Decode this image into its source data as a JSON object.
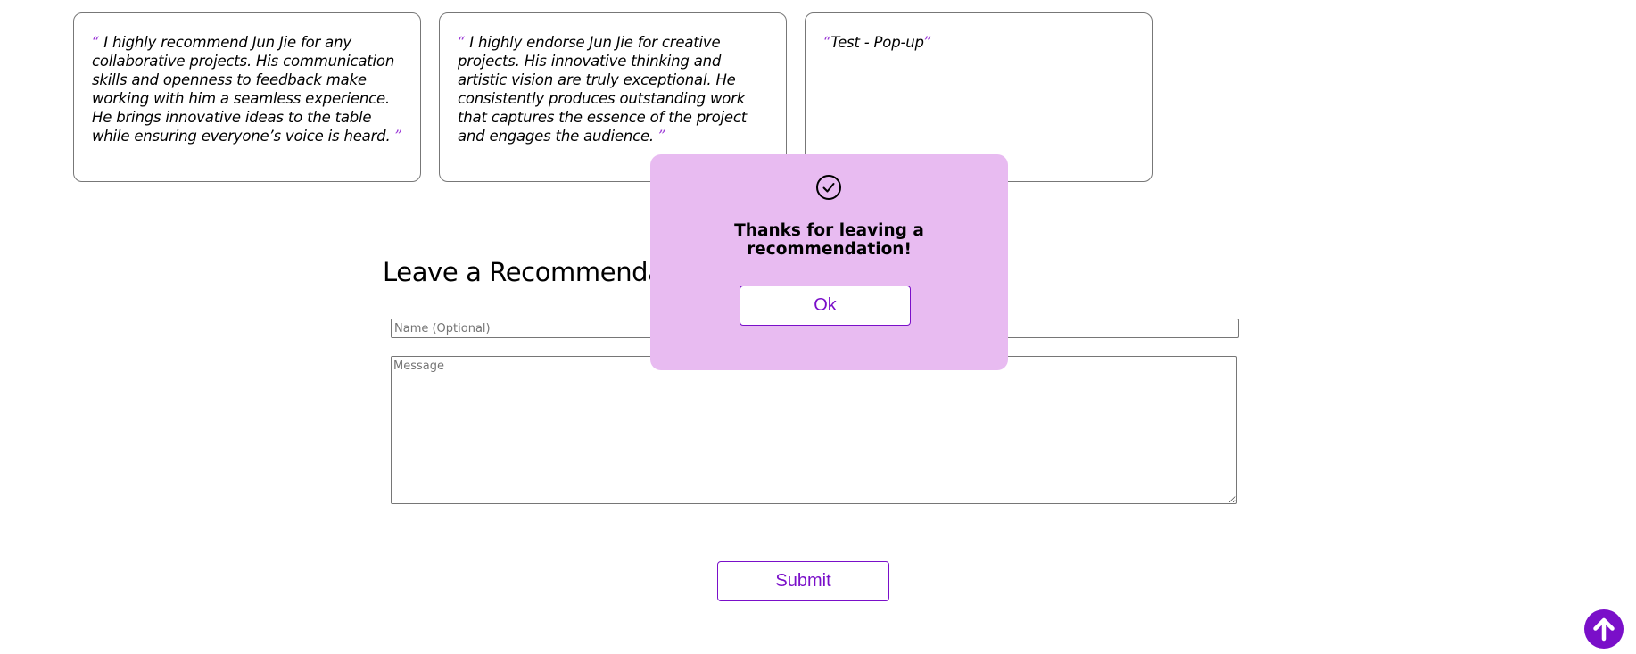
{
  "recommendations": [
    {
      "open_quote": "“",
      "text": " I highly recommend Jun Jie for any collaborative projects. His communication skills and openness to feedback make working with him a seamless experience. He brings innovative ideas to the table while ensuring everyone’s voice is heard. ",
      "close_quote": "”"
    },
    {
      "open_quote": "“",
      "text": " I highly endorse Jun Jie for creative projects. His innovative thinking and artistic vision are truly exceptional. He consistently produces outstanding work that captures the essence of the project and engages the audience. ",
      "close_quote": "”"
    },
    {
      "open_quote": "“",
      "text": "Test - Pop-up",
      "close_quote": "”"
    }
  ],
  "form": {
    "title": "Leave a Recommendation",
    "name_placeholder": "Name (Optional)",
    "message_placeholder": "Message",
    "submit_label": "Submit"
  },
  "popup": {
    "icon": "check-circle-icon",
    "message": "Thanks for leaving a recommendation!",
    "ok_label": "Ok"
  },
  "scroll_top": {
    "icon": "arrow-up-icon"
  },
  "colors": {
    "accent": "#7a0fc9",
    "popup_bg": "#e8bbf1",
    "quote_mark": "#9b39d6"
  }
}
